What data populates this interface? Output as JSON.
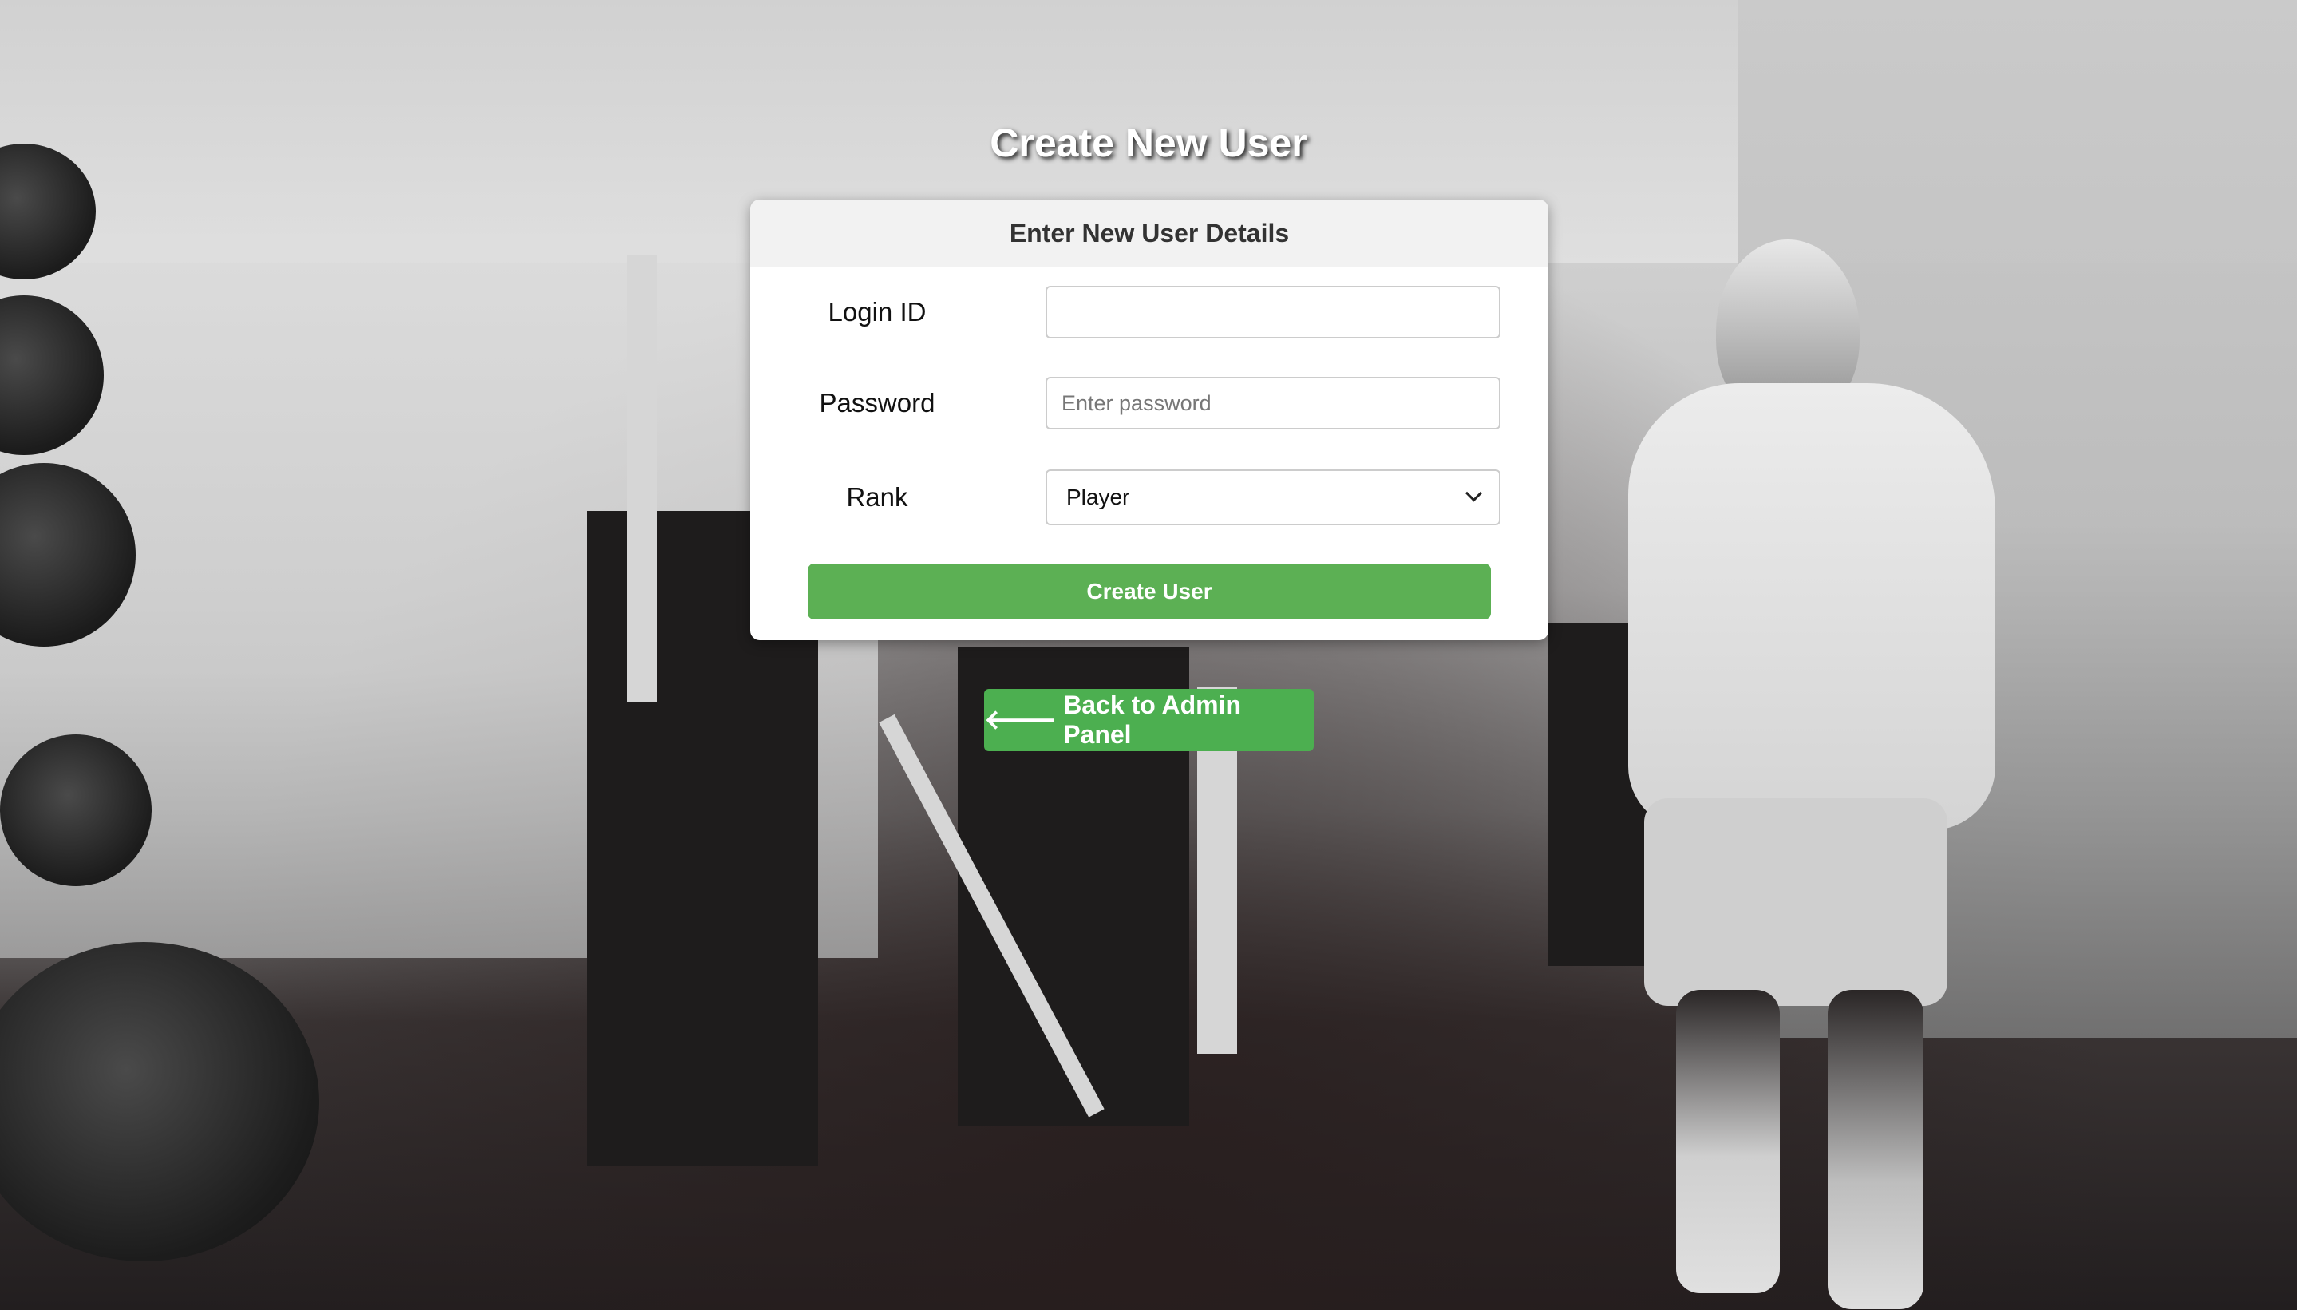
{
  "page": {
    "title": "Create New User"
  },
  "form": {
    "header": "Enter New User Details",
    "fields": {
      "login_id": {
        "label": "Login ID",
        "value": "",
        "placeholder": ""
      },
      "password": {
        "label": "Password",
        "value": "",
        "placeholder": "Enter password"
      },
      "rank": {
        "label": "Rank",
        "selected": "Player"
      }
    },
    "submit_label": "Create User"
  },
  "nav": {
    "back_icon": "arrow-left-icon",
    "back_label": "Back to Admin Panel"
  },
  "colors": {
    "primary_button": "#5cb054",
    "back_button": "#4caf50",
    "card_bg": "#ffffff",
    "card_header_bg": "#f2f2f2"
  }
}
